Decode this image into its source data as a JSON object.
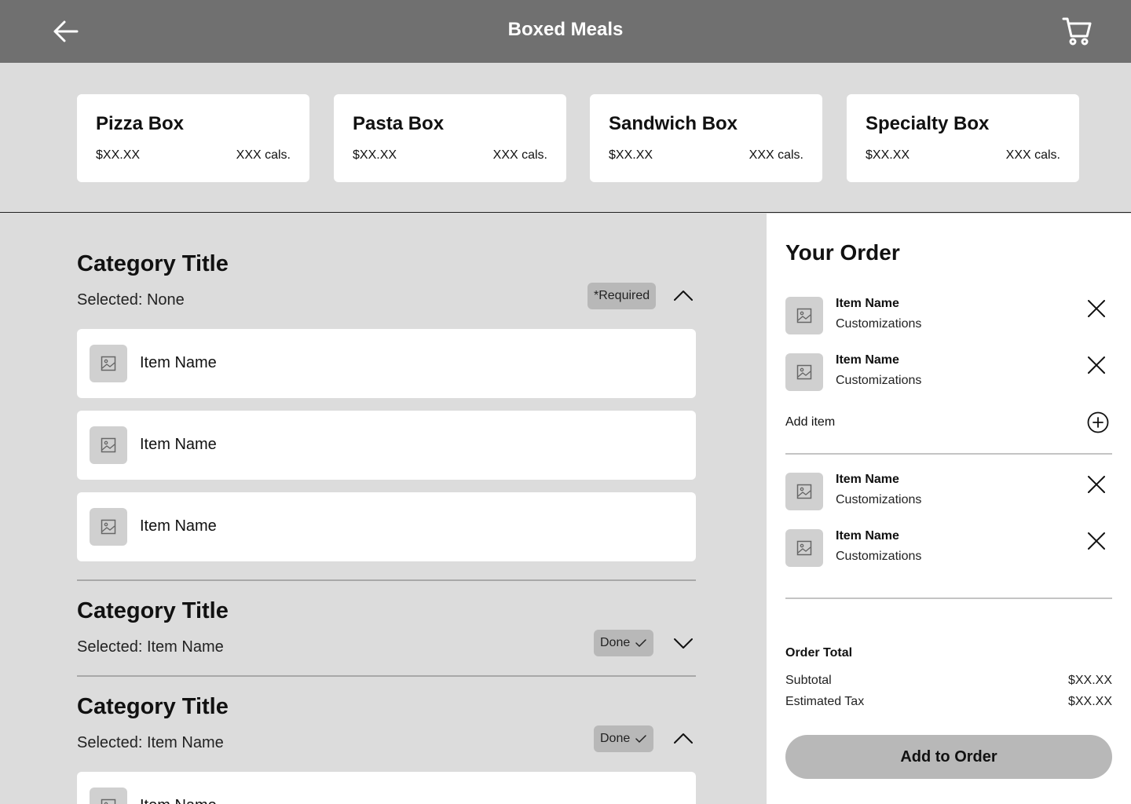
{
  "header": {
    "title": "Boxed Meals",
    "back_icon": "arrow-left-icon",
    "cart_icon": "cart-icon"
  },
  "boxes": [
    {
      "name": "Pizza Box",
      "price": "$XX.XX",
      "cals": "XXX cals."
    },
    {
      "name": "Pasta Box",
      "price": "$XX.XX",
      "cals": "XXX cals."
    },
    {
      "name": "Sandwich Box",
      "price": "$XX.XX",
      "cals": "XXX cals."
    },
    {
      "name": "Specialty Box",
      "price": "$XX.XX",
      "cals": "XXX cals."
    }
  ],
  "categories": [
    {
      "title": "Category Title",
      "selected": "Selected: None",
      "badge": "*Required",
      "expanded": true,
      "items": [
        {
          "name": "Item Name"
        },
        {
          "name": "Item Name"
        },
        {
          "name": "Item Name"
        }
      ]
    },
    {
      "title": "Category Title",
      "selected": "Selected: Item Name",
      "badge": "Done",
      "expanded": false,
      "items": []
    },
    {
      "title": "Category Title",
      "selected": "Selected: Item Name",
      "badge": "Done",
      "expanded": true,
      "items": [
        {
          "name": "Item Name"
        }
      ]
    }
  ],
  "order": {
    "title": "Your Order",
    "groups": [
      [
        {
          "name": "Item Name",
          "customizations": "Customizations"
        },
        {
          "name": "Item Name",
          "customizations": "Customizations"
        }
      ],
      [
        {
          "name": "Item Name",
          "customizations": "Customizations"
        },
        {
          "name": "Item Name",
          "customizations": "Customizations"
        }
      ]
    ],
    "add_item_label": "Add item",
    "total_title": "Order Total",
    "subtotal_label": "Subtotal",
    "subtotal_value": "$XX.XX",
    "tax_label": "Estimated Tax",
    "tax_value": "$XX.XX",
    "add_to_order_label": "Add to Order"
  },
  "colors": {
    "header": "#707070",
    "page": "#dcdcdc",
    "badge": "#b8b8b8",
    "button": "#b8b8b8"
  }
}
